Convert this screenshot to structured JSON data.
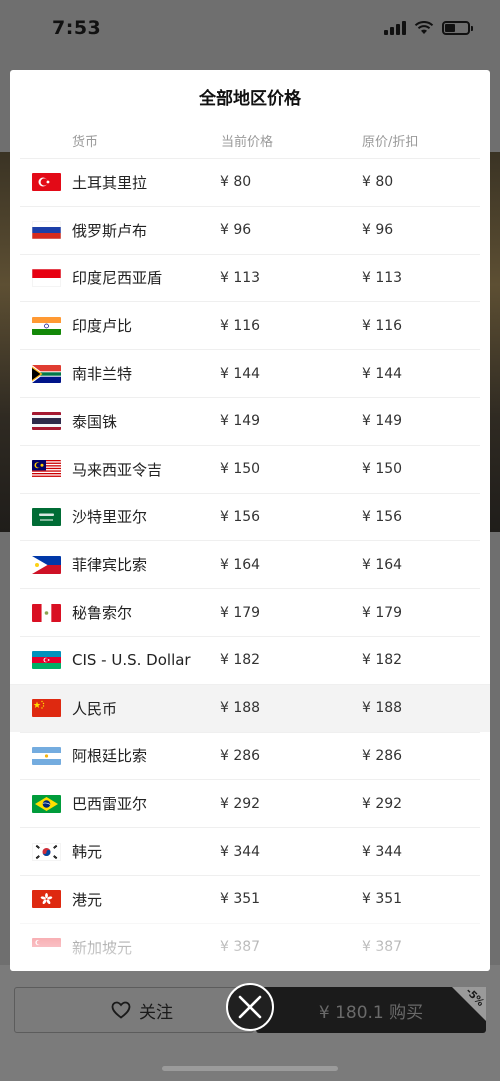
{
  "status_bar": {
    "time": "7:53"
  },
  "modal": {
    "title": "全部地区价格",
    "headers": {
      "currency": "货币",
      "current_price": "当前价格",
      "original_price": "原价/折扣"
    },
    "rows": [
      {
        "flag": "turkey-flag",
        "name": "土耳其里拉",
        "current": "¥ 80",
        "original": "¥ 80"
      },
      {
        "flag": "russia-flag",
        "name": "俄罗斯卢布",
        "current": "¥ 96",
        "original": "¥ 96"
      },
      {
        "flag": "indonesia-flag",
        "name": "印度尼西亚盾",
        "current": "¥ 113",
        "original": "¥ 113"
      },
      {
        "flag": "india-flag",
        "name": "印度卢比",
        "current": "¥ 116",
        "original": "¥ 116"
      },
      {
        "flag": "south-africa-flag",
        "name": "南非兰特",
        "current": "¥ 144",
        "original": "¥ 144"
      },
      {
        "flag": "thailand-flag",
        "name": "泰国铢",
        "current": "¥ 149",
        "original": "¥ 149"
      },
      {
        "flag": "malaysia-flag",
        "name": "马来西亚令吉",
        "current": "¥ 150",
        "original": "¥ 150"
      },
      {
        "flag": "saudi-arabia-flag",
        "name": "沙特里亚尔",
        "current": "¥ 156",
        "original": "¥ 156"
      },
      {
        "flag": "philippines-flag",
        "name": "菲律宾比索",
        "current": "¥ 164",
        "original": "¥ 164"
      },
      {
        "flag": "peru-flag",
        "name": "秘鲁索尔",
        "current": "¥ 179",
        "original": "¥ 179"
      },
      {
        "flag": "azerbaijan-flag",
        "name": "CIS - U.S. Dollar",
        "current": "¥ 182",
        "original": "¥ 182"
      },
      {
        "flag": "china-flag",
        "name": "人民币",
        "current": "¥ 188",
        "original": "¥ 188"
      },
      {
        "flag": "argentina-flag",
        "name": "阿根廷比索",
        "current": "¥ 286",
        "original": "¥ 286"
      },
      {
        "flag": "brazil-flag",
        "name": "巴西雷亚尔",
        "current": "¥ 292",
        "original": "¥ 292"
      },
      {
        "flag": "south-korea-flag",
        "name": "韩元",
        "current": "¥ 344",
        "original": "¥ 344"
      },
      {
        "flag": "hong-kong-flag",
        "name": "港元",
        "current": "¥ 351",
        "original": "¥ 351"
      },
      {
        "flag": "singapore-flag",
        "name": "新加坡元",
        "current": "¥ 387",
        "original": "¥ 387"
      }
    ]
  },
  "actions": {
    "follow_label": "关注",
    "buy_label": "¥ 180.1 购买",
    "discount_badge": "-5%"
  },
  "colors": {
    "overlay": "#6f6f6f",
    "highlight_row": "#f3f3f3",
    "buy_bg": "#1b1b1b"
  }
}
